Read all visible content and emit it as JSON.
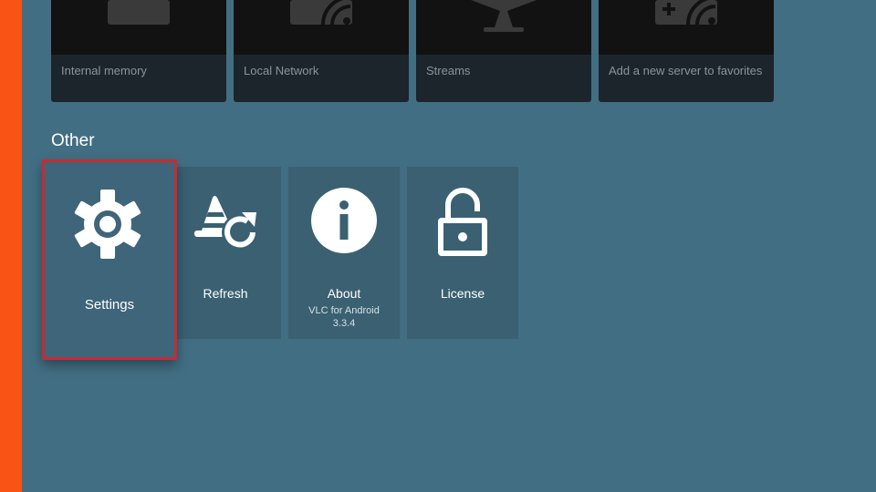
{
  "top_row": {
    "cards": [
      {
        "label": "Internal memory",
        "icon": "folder-icon"
      },
      {
        "label": "Local Network",
        "icon": "network-folder-icon"
      },
      {
        "label": "Streams",
        "icon": "antenna-icon"
      },
      {
        "label": "Add a new server to favorites",
        "icon": "add-server-icon"
      }
    ]
  },
  "other": {
    "title": "Other",
    "tiles": [
      {
        "title": "Settings",
        "icon": "gear-icon",
        "focused": true
      },
      {
        "title": "Refresh",
        "icon": "refresh-icon"
      },
      {
        "title": "About",
        "subtitle_line1": "VLC for Android",
        "subtitle_line2": "3.3.4",
        "icon": "info-icon"
      },
      {
        "title": "License",
        "icon": "lock-icon"
      }
    ]
  },
  "colors": {
    "background": "#426e83",
    "accent_bar": "#fa5316",
    "focus_border": "#c82a35",
    "tile": "#3a6072",
    "card": "#1c252b"
  }
}
